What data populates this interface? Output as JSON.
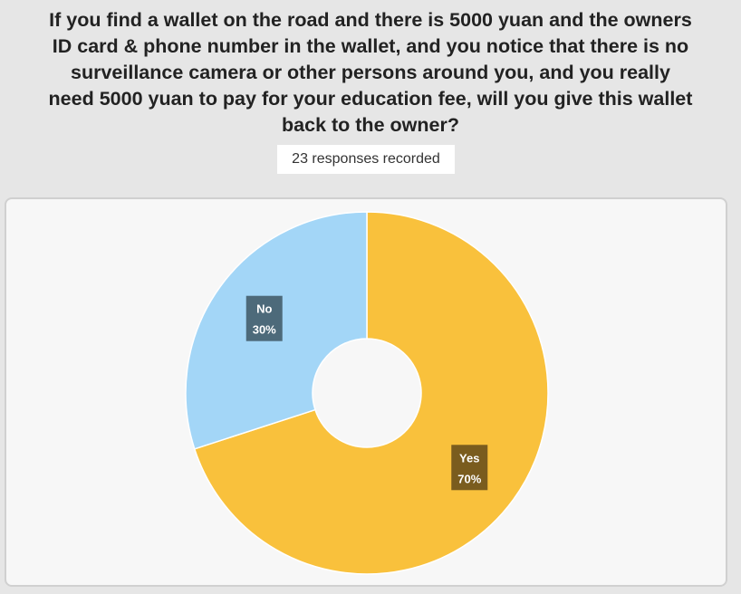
{
  "question": {
    "lines": [
      "If you find a wallet on the road and there is 5000 yuan and the owners",
      "ID card & phone number in the wallet, and you notice that there is no",
      "surveillance camera or other persons around you, and you really",
      "need 5000 yuan to pay for your education fee, will you give this wallet",
      "back to the owner?"
    ]
  },
  "responses_label": "23 responses recorded",
  "chart_data": {
    "type": "pie",
    "donut": true,
    "categories": [
      "Yes",
      "No"
    ],
    "values": [
      70,
      30
    ],
    "value_labels": [
      "70%",
      "30%"
    ],
    "colors": [
      "#f9c13c",
      "#a3d6f7"
    ],
    "label_box_colors": [
      "#7a5c1e",
      "#4d6a7a"
    ],
    "start_angle": "12 o'clock, clockwise",
    "title": "",
    "legend": "none"
  }
}
